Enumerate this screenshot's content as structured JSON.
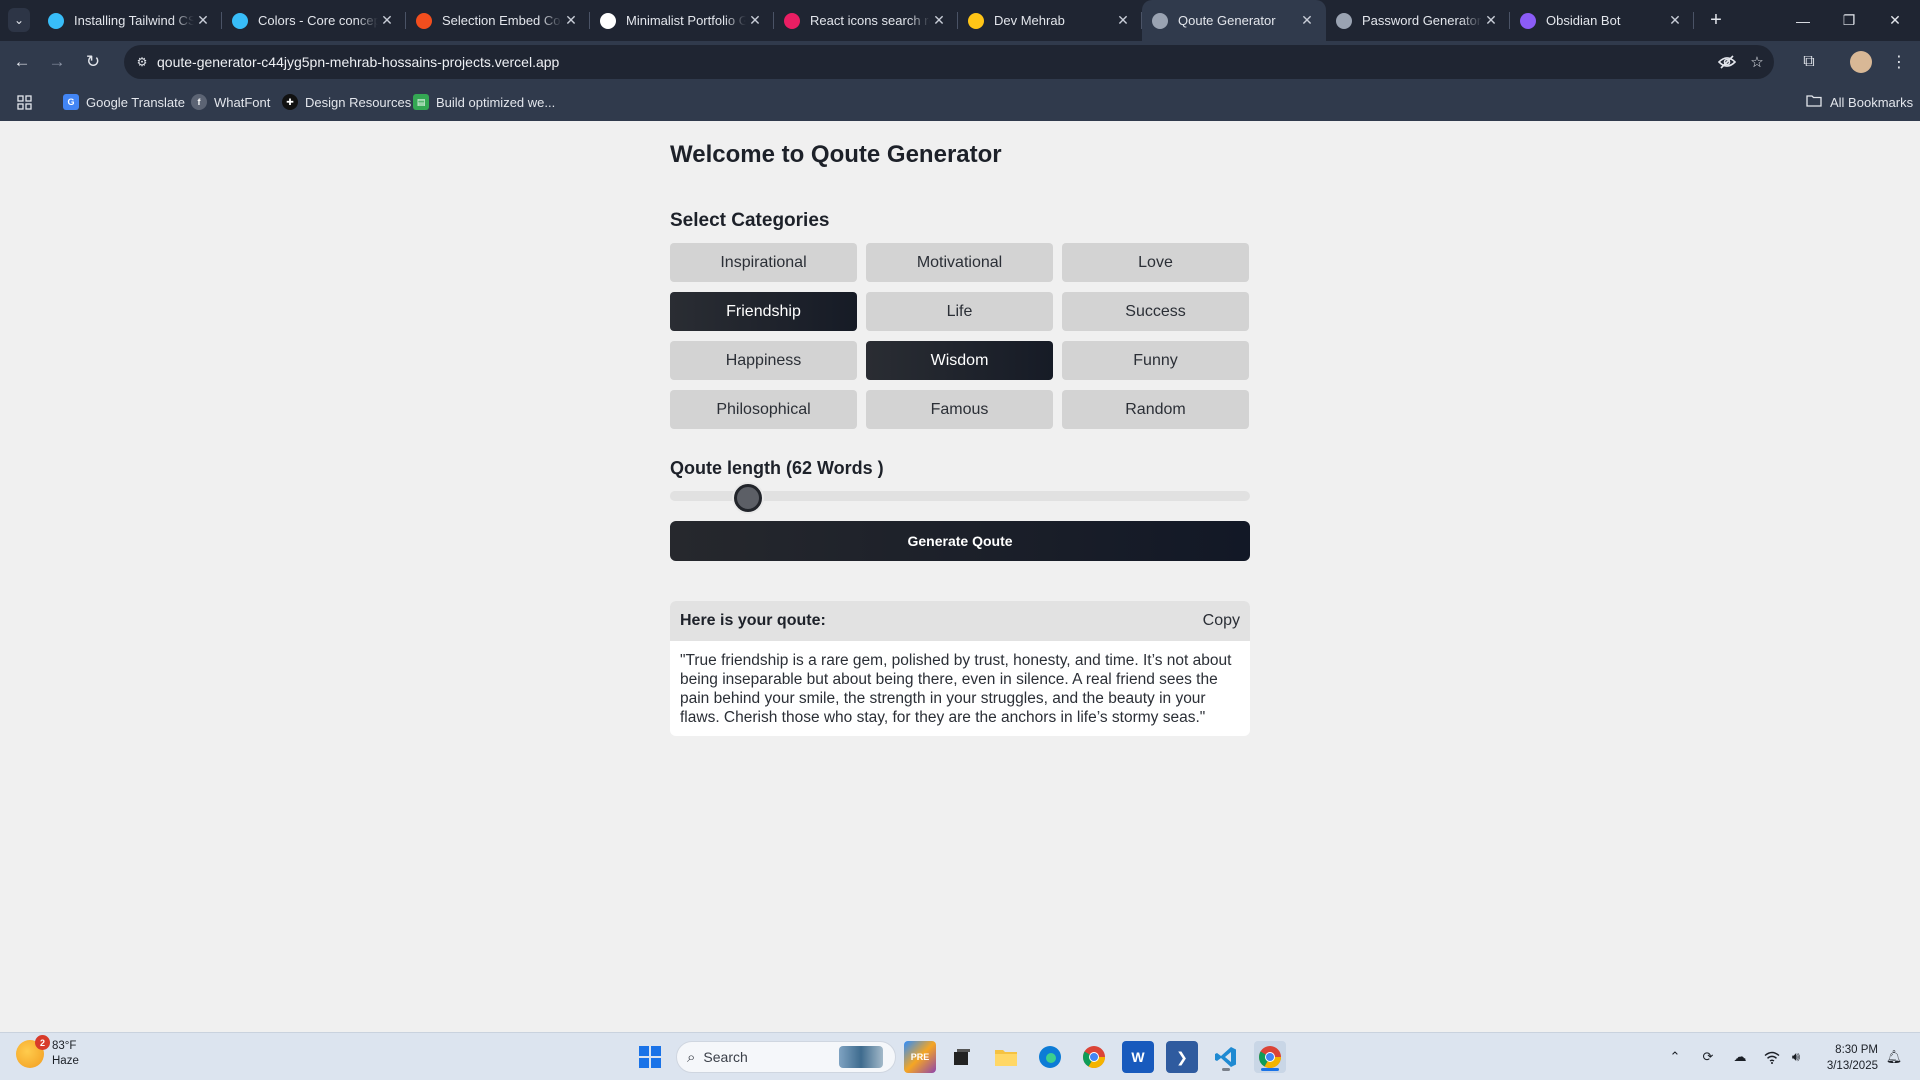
{
  "browser": {
    "tabs": [
      {
        "title": "Installing Tailwind CSS",
        "favicon": "tailwind-icon",
        "color": "#38bdf8",
        "active": false
      },
      {
        "title": "Colors - Core concepts",
        "favicon": "tailwind-icon",
        "color": "#38bdf8",
        "active": false
      },
      {
        "title": "Selection Embed Code",
        "favicon": "figma-icon",
        "color": "#f24e1e",
        "active": false
      },
      {
        "title": "Minimalist Portfolio Generator",
        "favicon": "github-icon",
        "color": "#ffffff",
        "active": false
      },
      {
        "title": "React icons search results",
        "favicon": "react-icons-icon",
        "color": "#e91e63",
        "active": false
      },
      {
        "title": "Dev Mehrab",
        "favicon": "vite-icon",
        "color": "#ffc517",
        "active": false
      },
      {
        "title": "Qoute Generator",
        "favicon": "globe-icon",
        "color": "#9aa3b2",
        "active": true
      },
      {
        "title": "Password Generator",
        "favicon": "globe-icon",
        "color": "#9aa3b2",
        "active": false
      },
      {
        "title": "Obsidian Bot",
        "favicon": "obsidian-icon",
        "color": "#8b5cf6",
        "active": false
      }
    ],
    "url": "qoute-generator-c44jyg5pn-mehrab-hossains-projects.vercel.app",
    "bookmarks": [
      {
        "label": "Google Translate",
        "icon": "google-translate-icon",
        "color": "#4285f4"
      },
      {
        "label": "WhatFont",
        "icon": "whatfont-icon",
        "color": "#e3e6ec"
      },
      {
        "label": "Design Resources",
        "icon": "design-resources-icon",
        "color": "#ffffff"
      },
      {
        "label": "Build optimized we...",
        "icon": "build-icon",
        "color": "#34a853"
      }
    ],
    "all_bookmarks": "All Bookmarks"
  },
  "page": {
    "title": "Welcome to Qoute Generator",
    "categories_title": "Select Categories",
    "categories": [
      {
        "label": "Inspirational",
        "selected": false
      },
      {
        "label": "Motivational",
        "selected": false
      },
      {
        "label": "Love",
        "selected": false
      },
      {
        "label": "Friendship",
        "selected": true
      },
      {
        "label": "Life",
        "selected": false
      },
      {
        "label": "Success",
        "selected": false
      },
      {
        "label": "Happiness",
        "selected": false
      },
      {
        "label": "Wisdom",
        "selected": true
      },
      {
        "label": "Funny",
        "selected": false
      },
      {
        "label": "Philosophical",
        "selected": false
      },
      {
        "label": "Famous",
        "selected": false
      },
      {
        "label": "Random",
        "selected": false
      }
    ],
    "length_label": "Qoute length (62 Words )",
    "length_fraction": 0.135,
    "generate_button": "Generate Qoute",
    "result_label": "Here is your qoute:",
    "copy_label": "Copy",
    "quote": "\"True friendship is a rare gem, polished by trust, honesty, and time. It’s not about being inseparable but about being there, even in silence. A real friend sees the pain behind your smile, the strength in your struggles, and the beauty in your flaws. Cherish those who stay, for they are the anchors in life’s stormy seas.\""
  },
  "taskbar": {
    "weather_temp": "83°F",
    "weather_desc": "Haze",
    "weather_badge": "2",
    "search_placeholder": "Search",
    "time": "8:30 PM",
    "date": "3/13/2025"
  },
  "colors": {
    "accent_dark": "#161b26",
    "chrome_bg": "#1f2532",
    "chrome_toolbar": "#303a4c",
    "page_bg": "#f0f0f0"
  }
}
